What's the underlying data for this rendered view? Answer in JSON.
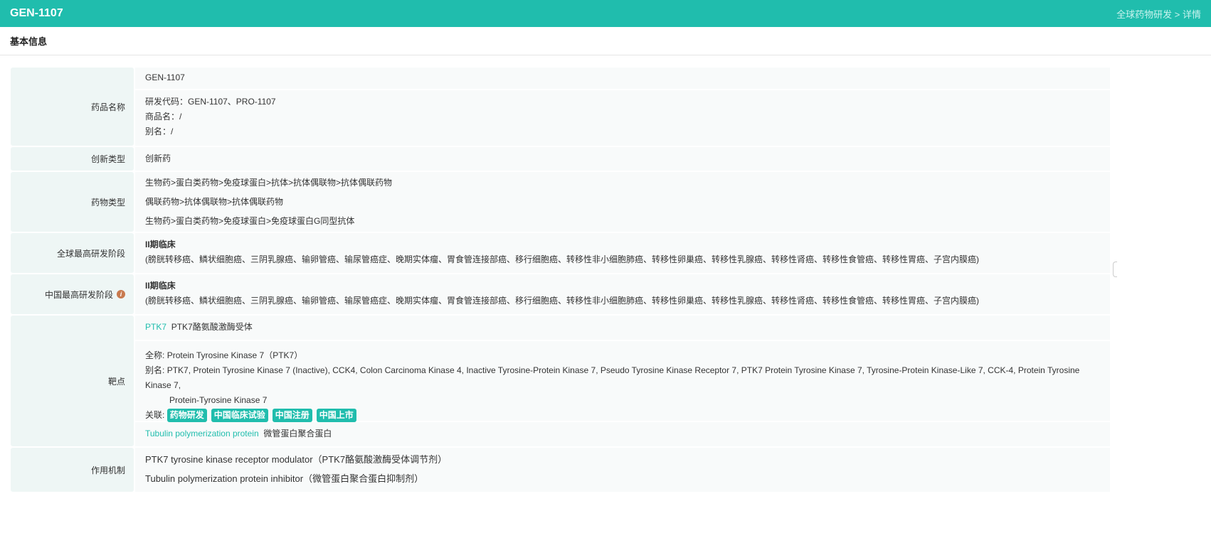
{
  "header": {
    "title": "GEN-1107",
    "breadcrumb": "全球药物研发 > 详情"
  },
  "section_title": "基本信息",
  "rows": {
    "name": {
      "label": "药品名称",
      "main": "GEN-1107",
      "code": "研发代码：GEN-1107、PRO-1107",
      "trade": "商品名：/",
      "alias": "别名：/"
    },
    "innovation": {
      "label": "创新类型",
      "value": "创新药"
    },
    "drug_type": {
      "label": "药物类型",
      "values": [
        "生物药>蛋白类药物>免疫球蛋白>抗体>抗体偶联物>抗体偶联药物",
        "偶联药物>抗体偶联物>抗体偶联药物",
        "生物药>蛋白类药物>免疫球蛋白>免疫球蛋白G同型抗体"
      ]
    },
    "global_phase": {
      "label": "全球最高研发阶段",
      "phase": "II期临床",
      "indications": "(膀胱转移癌、鳞状细胞癌、三阴乳腺癌、输卵管癌、输尿管癌症、晚期实体瘤、胃食管连接部癌、移行细胞癌、转移性非小细胞肺癌、转移性卵巢癌、转移性乳腺癌、转移性肾癌、转移性食管癌、转移性胃癌、子宫内膜癌)"
    },
    "china_phase": {
      "label": "中国最高研发阶段",
      "info_icon": "i",
      "phase": "II期临床",
      "indications": "(膀胱转移癌、鳞状细胞癌、三阴乳腺癌、输卵管癌、输尿管癌症、晚期实体瘤、胃食管连接部癌、移行细胞癌、转移性非小细胞肺癌、转移性卵巢癌、转移性乳腺癌、转移性肾癌、转移性食管癌、转移性胃癌、子宫内膜癌)"
    },
    "target": {
      "label": "靶点",
      "t1": {
        "code": "PTK7",
        "name": "PTK7酪氨酸激酶受体",
        "full_label": "全称:",
        "full": "Protein Tyrosine Kinase 7（PTK7）",
        "alias_label": "别名:",
        "alias": "PTK7, Protein Tyrosine Kinase 7 (Inactive), CCK4, Colon Carcinoma Kinase 4, Inactive Tyrosine-Protein Kinase 7, Pseudo Tyrosine Kinase Receptor 7, PTK7 Protein Tyrosine Kinase 7, Tyrosine-Protein Kinase-Like 7, CCK-4, Protein Tyrosine Kinase 7,",
        "alias_cont": "Protein-Tyrosine Kinase 7",
        "rel_label": "关联:",
        "tags": [
          "药物研发",
          "中国临床试验",
          "中国注册",
          "中国上市"
        ]
      },
      "t2": {
        "code": "Tubulin polymerization protein",
        "name": "微管蛋白聚合蛋白"
      }
    },
    "mechanism": {
      "label": "作用机制",
      "values": [
        "PTK7 tyrosine kinase receptor modulator（PTK7酪氨酸激酶受体调节剂）",
        "Tubulin polymerization protein inhibitor（微管蛋白聚合蛋白抑制剂）"
      ]
    }
  },
  "colors": {
    "brand": "#20bdad"
  }
}
